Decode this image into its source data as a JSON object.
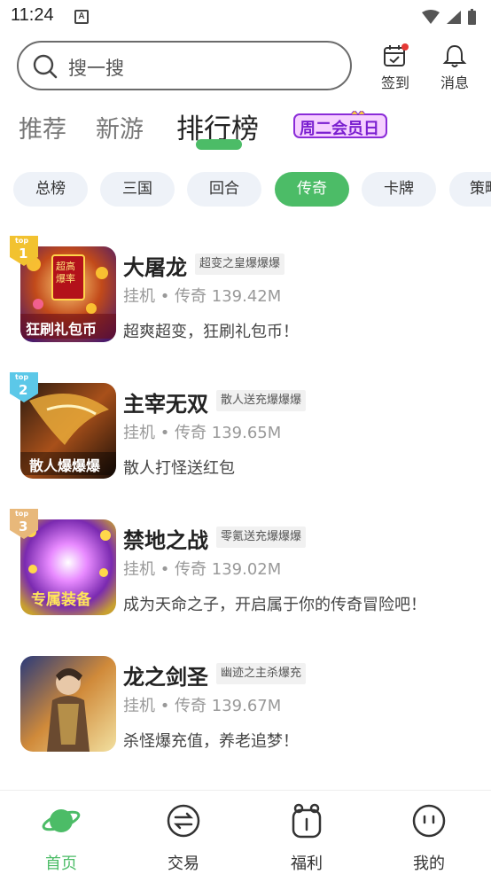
{
  "status_bar": {
    "time": "11:24",
    "notification_letter": "A"
  },
  "search": {
    "placeholder": "搜一搜"
  },
  "top_actions": {
    "checkin_label": "签到",
    "messages_label": "消息"
  },
  "tabs": [
    {
      "label": "推荐",
      "active": false
    },
    {
      "label": "新游",
      "active": false
    },
    {
      "label": "排行榜",
      "active": true
    }
  ],
  "promo_banner": {
    "text": "周二会员日"
  },
  "chips": [
    {
      "label": "总榜",
      "active": false
    },
    {
      "label": "三国",
      "active": false
    },
    {
      "label": "回合",
      "active": false
    },
    {
      "label": "传奇",
      "active": true
    },
    {
      "label": "卡牌",
      "active": false
    },
    {
      "label": "策略",
      "active": false
    }
  ],
  "games": [
    {
      "rank": "1",
      "rank_label": "top",
      "title": "大屠龙",
      "tag": "超变之皇爆爆爆",
      "meta": "挂机 • 传奇 139.42M",
      "desc": "超爽超变，狂刷礼包币！",
      "thumb_text": "狂刷礼包币",
      "thumb_badge": "超高爆率"
    },
    {
      "rank": "2",
      "rank_label": "top",
      "title": "主宰无双",
      "tag": "散人送充爆爆爆",
      "meta": "挂机 • 传奇 139.65M",
      "desc": "散人打怪送红包",
      "thumb_text": "散人爆爆爆"
    },
    {
      "rank": "3",
      "rank_label": "top",
      "title": "禁地之战",
      "tag": "零氪送充爆爆爆",
      "meta": "挂机 • 传奇 139.02M",
      "desc": "成为天命之子，开启属于你的传奇冒险吧！",
      "thumb_text": "专属装备"
    },
    {
      "rank": "",
      "rank_label": "",
      "title": "龙之剑圣",
      "tag": "幽迹之主杀爆充",
      "meta": "挂机 • 传奇 139.67M",
      "desc": "杀怪爆充值，养老追梦！",
      "thumb_text": ""
    }
  ],
  "bottom_nav": [
    {
      "label": "首页",
      "icon": "planet-icon",
      "active": true
    },
    {
      "label": "交易",
      "icon": "exchange-icon",
      "active": false
    },
    {
      "label": "福利",
      "icon": "gift-icon",
      "active": false
    },
    {
      "label": "我的",
      "icon": "face-icon",
      "active": false
    }
  ],
  "colors": {
    "accent": "#4cbc67",
    "chip_bg": "#eef2f8",
    "rank1": "#f2c230",
    "rank2": "#5cc8e8",
    "rank3": "#e8b87a"
  }
}
